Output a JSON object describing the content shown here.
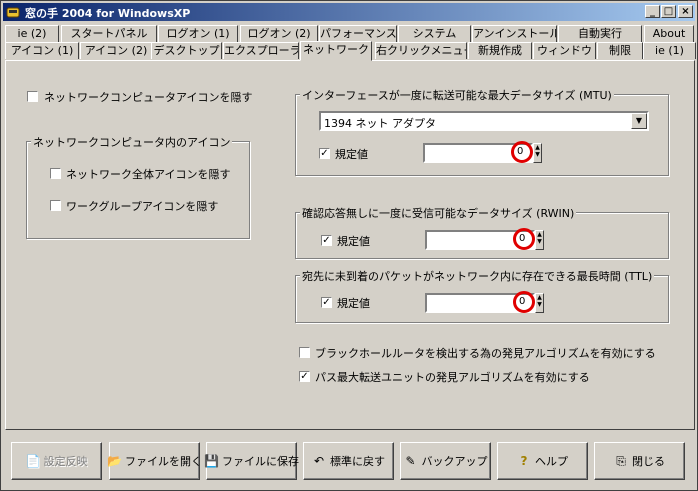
{
  "window": {
    "title": "窓の手 2004 for WindowsXP"
  },
  "tabs_row1": [
    "ie (2)",
    "スタートパネル",
    "ログオン (1)",
    "ログオン (2)",
    "パフォーマンス",
    "システム",
    "アンインストール",
    "自動実行",
    "About"
  ],
  "tabs_row2": [
    "アイコン (1)",
    "アイコン (2)",
    "デスクトップ",
    "エクスプローラ",
    "ネットワーク",
    "右クリックメニュー",
    "新規作成",
    "ウィンドウ",
    "制限",
    "ie (1)"
  ],
  "active_tab": "ネットワーク",
  "left": {
    "hide_network_icon": {
      "label": "ネットワークコンピュータアイコンを隠す",
      "checked": false
    },
    "group_title": "ネットワークコンピュータ内のアイコン",
    "hide_entire_network": {
      "label": "ネットワーク全体アイコンを隠す",
      "checked": false
    },
    "hide_workgroup": {
      "label": "ワークグループアイコンを隠す",
      "checked": false
    }
  },
  "mtu": {
    "title": "インターフェースが一度に転送可能な最大データサイズ (MTU)",
    "adapter": "1394 ネット アダプタ",
    "default_label": "規定値",
    "default_checked": true,
    "value": "0"
  },
  "rwin": {
    "title": "確認応答無しに一度に受信可能なデータサイズ (RWIN)",
    "default_label": "規定値",
    "default_checked": true,
    "value": "0"
  },
  "ttl": {
    "title": "宛先に未到着のパケットがネットワーク内に存在できる最長時間 (TTL)",
    "default_label": "規定値",
    "default_checked": true,
    "value": "0"
  },
  "blackhole": {
    "label": "ブラックホールルータを検出する為の発見アルゴリズムを有効にする",
    "checked": false
  },
  "pmtu": {
    "label": "パス最大転送ユニットの発見アルゴリズムを有効にする",
    "checked": true
  },
  "buttons": {
    "apply": "設定反映",
    "open": "ファイルを開く",
    "save": "ファイルに保存",
    "reset": "標準に戻す",
    "backup": "バックアップ",
    "help": "ヘルプ",
    "close": "閉じる"
  },
  "titlebar_buttons": {
    "minimize": "_",
    "maximize": "□",
    "close": "×"
  },
  "colors": {
    "face": "#d4d0c8",
    "title_start": "#0a246a",
    "title_end": "#a6caf0",
    "highlight_circle": "#e00000"
  }
}
